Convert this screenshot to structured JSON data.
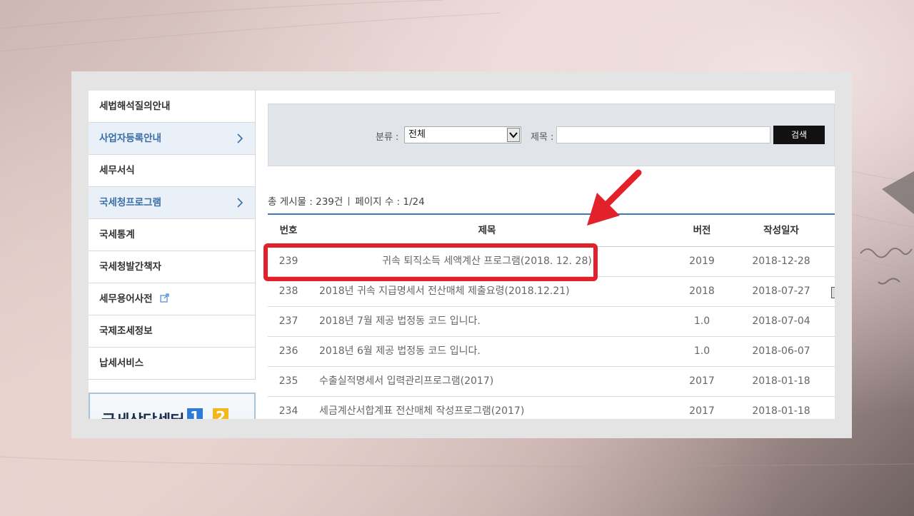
{
  "sidebar": {
    "items": [
      {
        "label": "세법해석질의안내",
        "active": false,
        "chevron": false,
        "external": false
      },
      {
        "label": "사업자등록안내",
        "active": true,
        "chevron": true,
        "external": false
      },
      {
        "label": "세무서식",
        "active": false,
        "chevron": false,
        "external": false
      },
      {
        "label": "국세청프로그램",
        "active": true,
        "chevron": true,
        "external": false
      },
      {
        "label": "국세통계",
        "active": false,
        "chevron": false,
        "external": false
      },
      {
        "label": "국세청발간책자",
        "active": false,
        "chevron": false,
        "external": false
      },
      {
        "label": "세무용어사전",
        "active": false,
        "chevron": false,
        "external": true
      },
      {
        "label": "국제조세정보",
        "active": false,
        "chevron": false,
        "external": false
      },
      {
        "label": "납세서비스",
        "active": false,
        "chevron": false,
        "external": false
      }
    ],
    "banner": {
      "text": "국세상담센터",
      "num1": "1",
      "num2": "2"
    }
  },
  "search": {
    "category_label": "분류 :",
    "category_value": "전체",
    "title_label": "제목 :",
    "title_value": "",
    "button_label": "검색"
  },
  "summary": {
    "total": "총 게시물 : 239건",
    "pages": "페이지 수 : 1/24"
  },
  "table": {
    "headers": {
      "no": "번호",
      "title": "제목",
      "version": "버전",
      "date": "작성일자"
    },
    "rows": [
      {
        "no": "239",
        "title": "귀속 퇴직소득 세액계산 프로그램(2018. 12. 28)",
        "version": "2019",
        "date": "2018-12-28"
      },
      {
        "no": "238",
        "title": "2018년 귀속 지급명세서 전산매체 제출요령(2018.12.21)",
        "version": "2018",
        "date": "2018-07-27"
      },
      {
        "no": "237",
        "title": "2018년 7월 제공 법정동 코드 입니다.",
        "version": "1.0",
        "date": "2018-07-04"
      },
      {
        "no": "236",
        "title": "2018년 6월 제공 법정동 코드 입니다.",
        "version": "1.0",
        "date": "2018-06-07"
      },
      {
        "no": "235",
        "title": "수출실적명세서 입력관리프로그램(2017)",
        "version": "2017",
        "date": "2018-01-18"
      },
      {
        "no": "234",
        "title": "세금계산서합계표 전산매체 작성프로그램(2017)",
        "version": "2017",
        "date": "2018-01-18"
      }
    ]
  },
  "annotation": {
    "highlight_color": "#e2212b"
  },
  "colors": {
    "accent": "#3a6ea8",
    "table_top": "#3c78b8",
    "active_bg": "#e9f0f7"
  }
}
